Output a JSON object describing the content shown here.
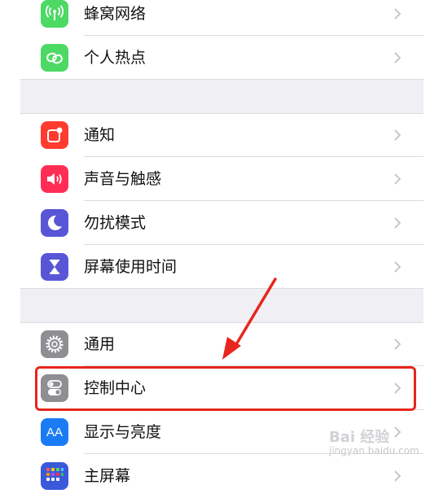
{
  "settings": {
    "group1": [
      {
        "label": "蜂窝网络",
        "icon": "antenna-icon",
        "color": "#4cd964"
      },
      {
        "label": "个人热点",
        "icon": "hotspot-link-icon",
        "color": "#4cd964"
      }
    ],
    "group2": [
      {
        "label": "通知",
        "icon": "notifications-icon",
        "color": "#ff3b30"
      },
      {
        "label": "声音与触感",
        "icon": "speaker-icon",
        "color": "#ff2d55"
      },
      {
        "label": "勿扰模式",
        "icon": "moon-icon",
        "color": "#5856d6"
      },
      {
        "label": "屏幕使用时间",
        "icon": "hourglass-icon",
        "color": "#5856d6"
      }
    ],
    "group3": [
      {
        "label": "通用",
        "icon": "gear-icon",
        "color": "#8e8e93"
      },
      {
        "label": "控制中心",
        "icon": "toggles-icon",
        "color": "#8e8e93"
      },
      {
        "label": "显示与亮度",
        "icon": "aa-display-icon",
        "color": "#1a7cf5",
        "glyph": "AA"
      },
      {
        "label": "主屏幕",
        "icon": "home-grid-icon",
        "color": "#3a59d9"
      }
    ]
  },
  "annotation": {
    "highlight_color": "#e8261e",
    "highlighted_item": "控制中心"
  },
  "watermark": {
    "brand": "Bai 经验",
    "sub": "jingyan.baidu.com"
  }
}
